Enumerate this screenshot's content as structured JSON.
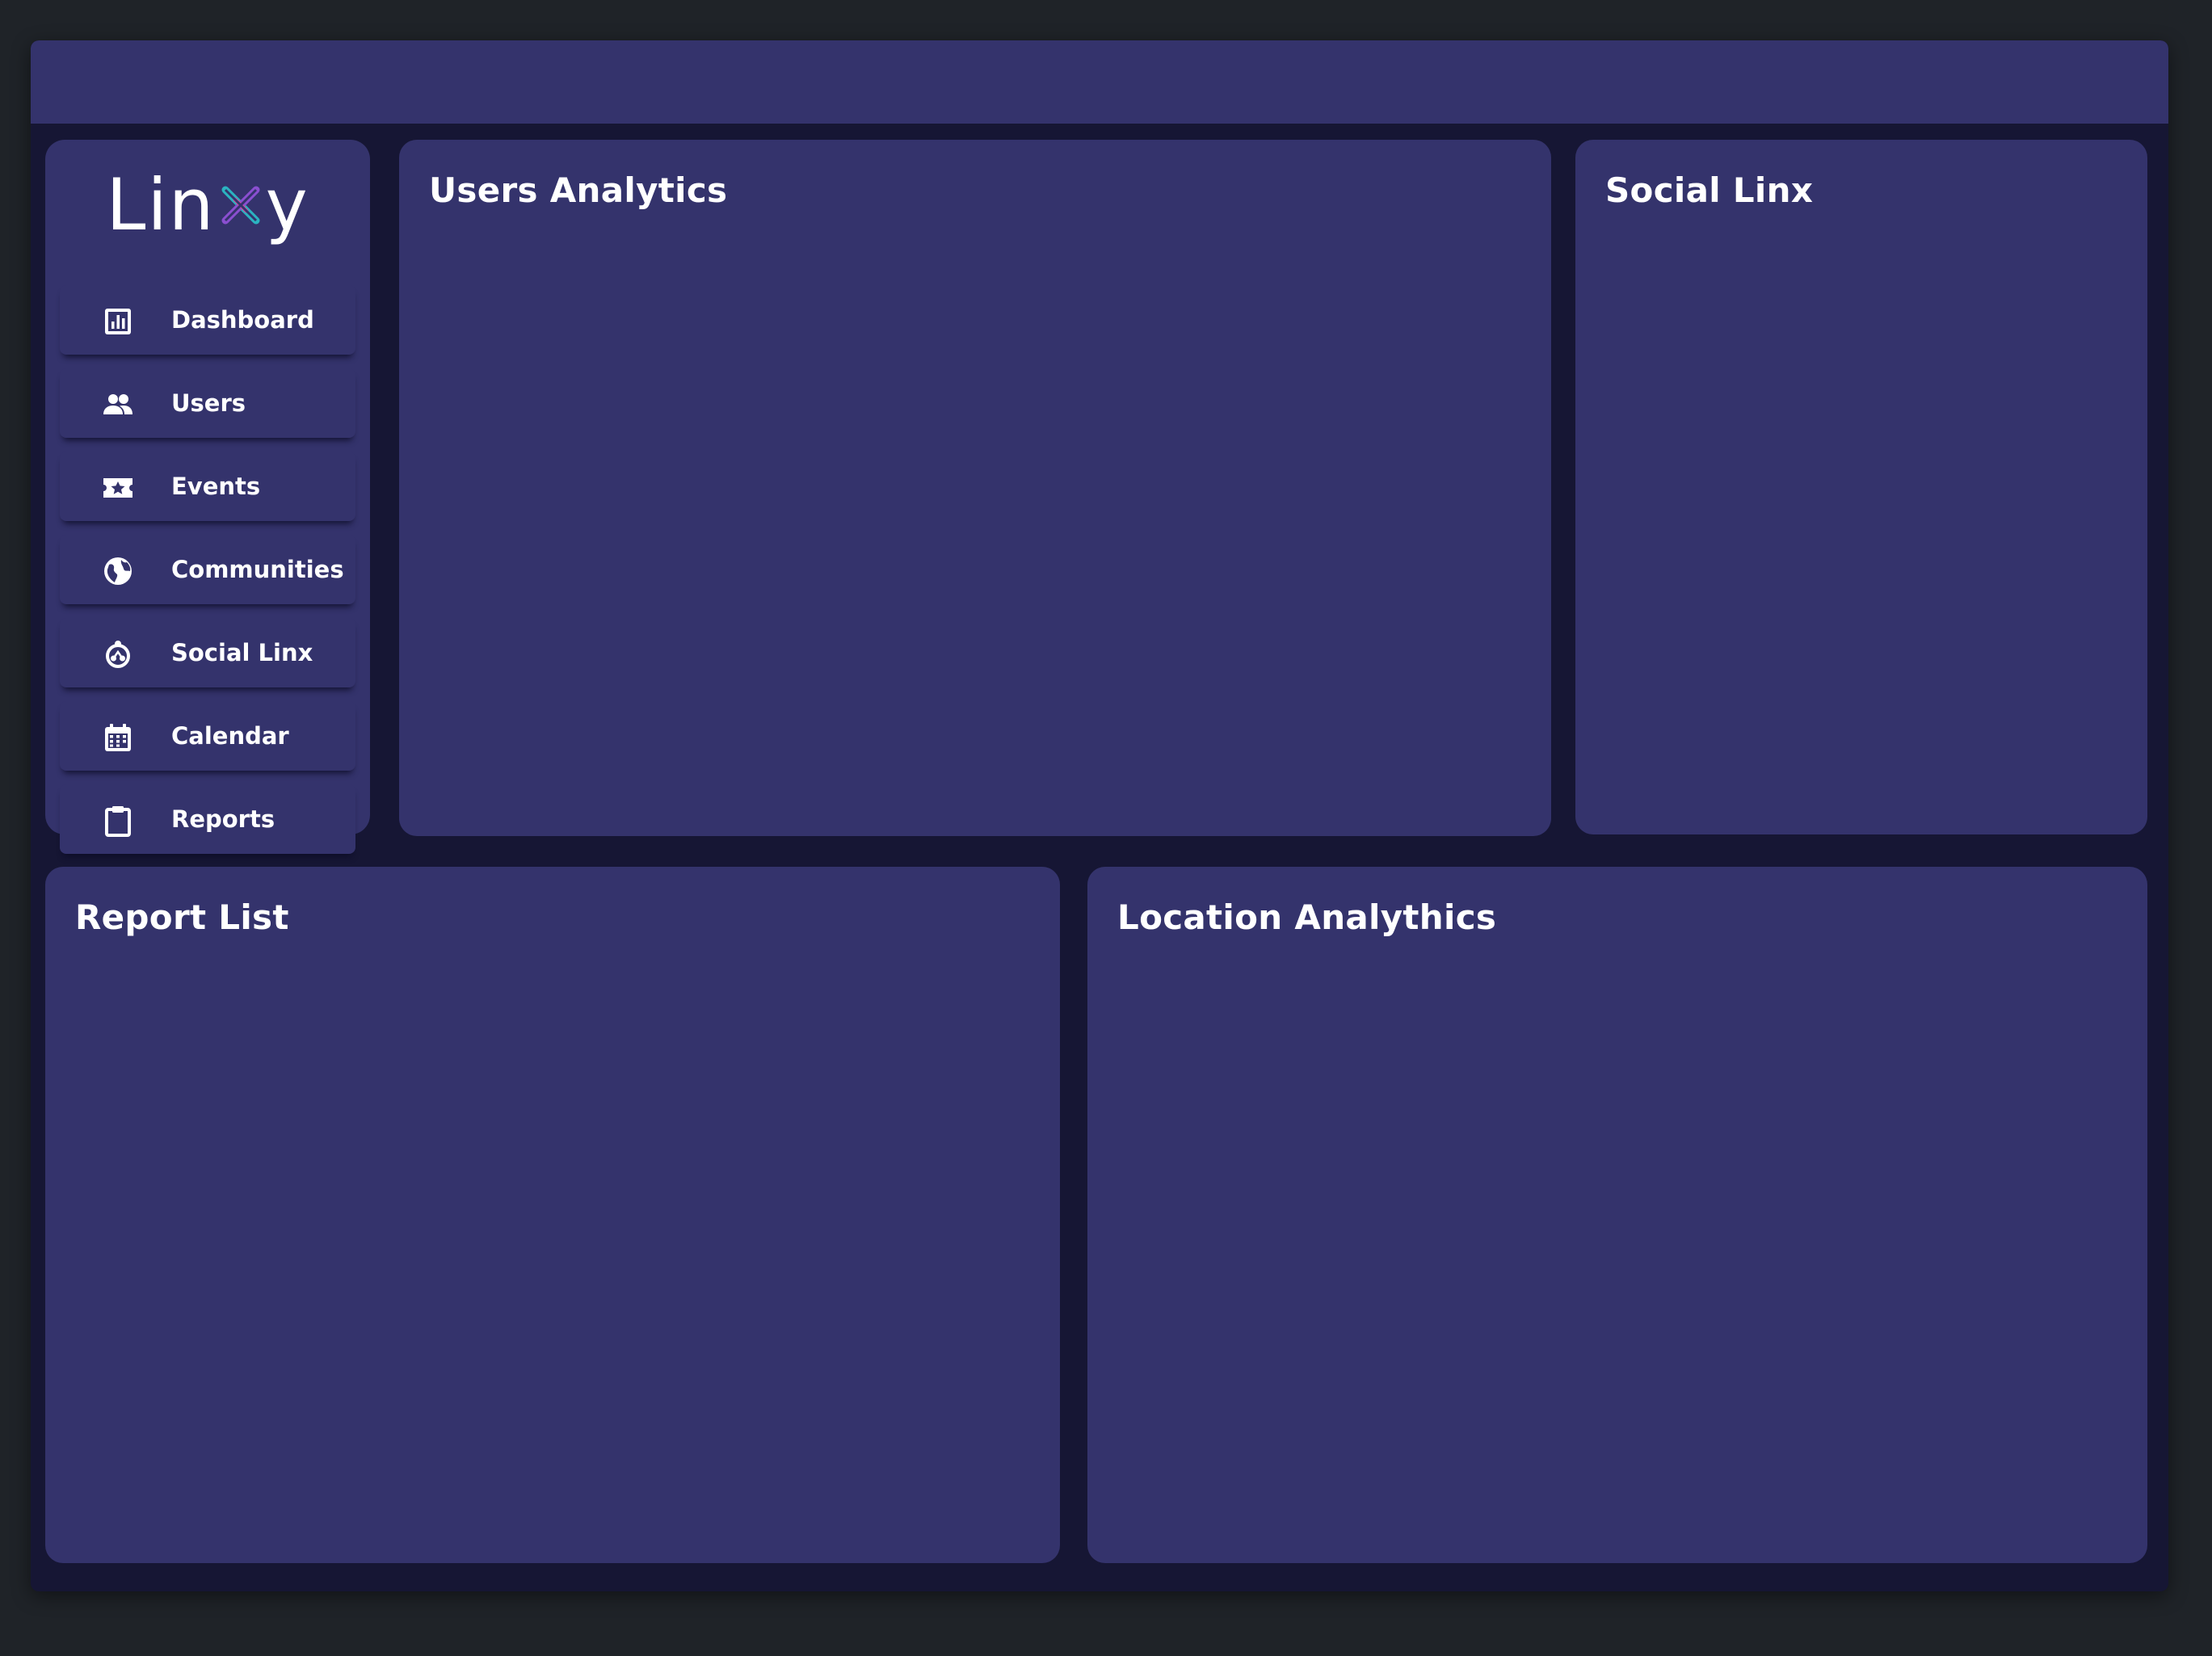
{
  "app": {
    "name_parts": [
      "Lin",
      "y"
    ]
  },
  "sidebar": {
    "items": [
      {
        "label": "Dashboard",
        "icon": "dashboard-icon"
      },
      {
        "label": "Users",
        "icon": "users-icon"
      },
      {
        "label": "Events",
        "icon": "ticket-icon"
      },
      {
        "label": "Communities",
        "icon": "globe-icon"
      },
      {
        "label": "Social Linx",
        "icon": "social-linx-icon"
      },
      {
        "label": "Calendar",
        "icon": "calendar-icon"
      },
      {
        "label": "Reports",
        "icon": "clipboard-icon"
      }
    ]
  },
  "panels": {
    "users_analytics": {
      "title": "Users Analytics"
    },
    "social_linx": {
      "title": "Social Linx"
    },
    "report_list": {
      "title": "Report List"
    },
    "location_analytics": {
      "title": "Location Analythics"
    }
  },
  "colors": {
    "background": "#1f2328",
    "frame": "#161634",
    "panel": "#34336c",
    "text": "#ffffff",
    "logo_x_teal": "#2bb3c0",
    "logo_x_purple": "#8a4fd0",
    "logo_x_pink": "#d04fa0"
  }
}
